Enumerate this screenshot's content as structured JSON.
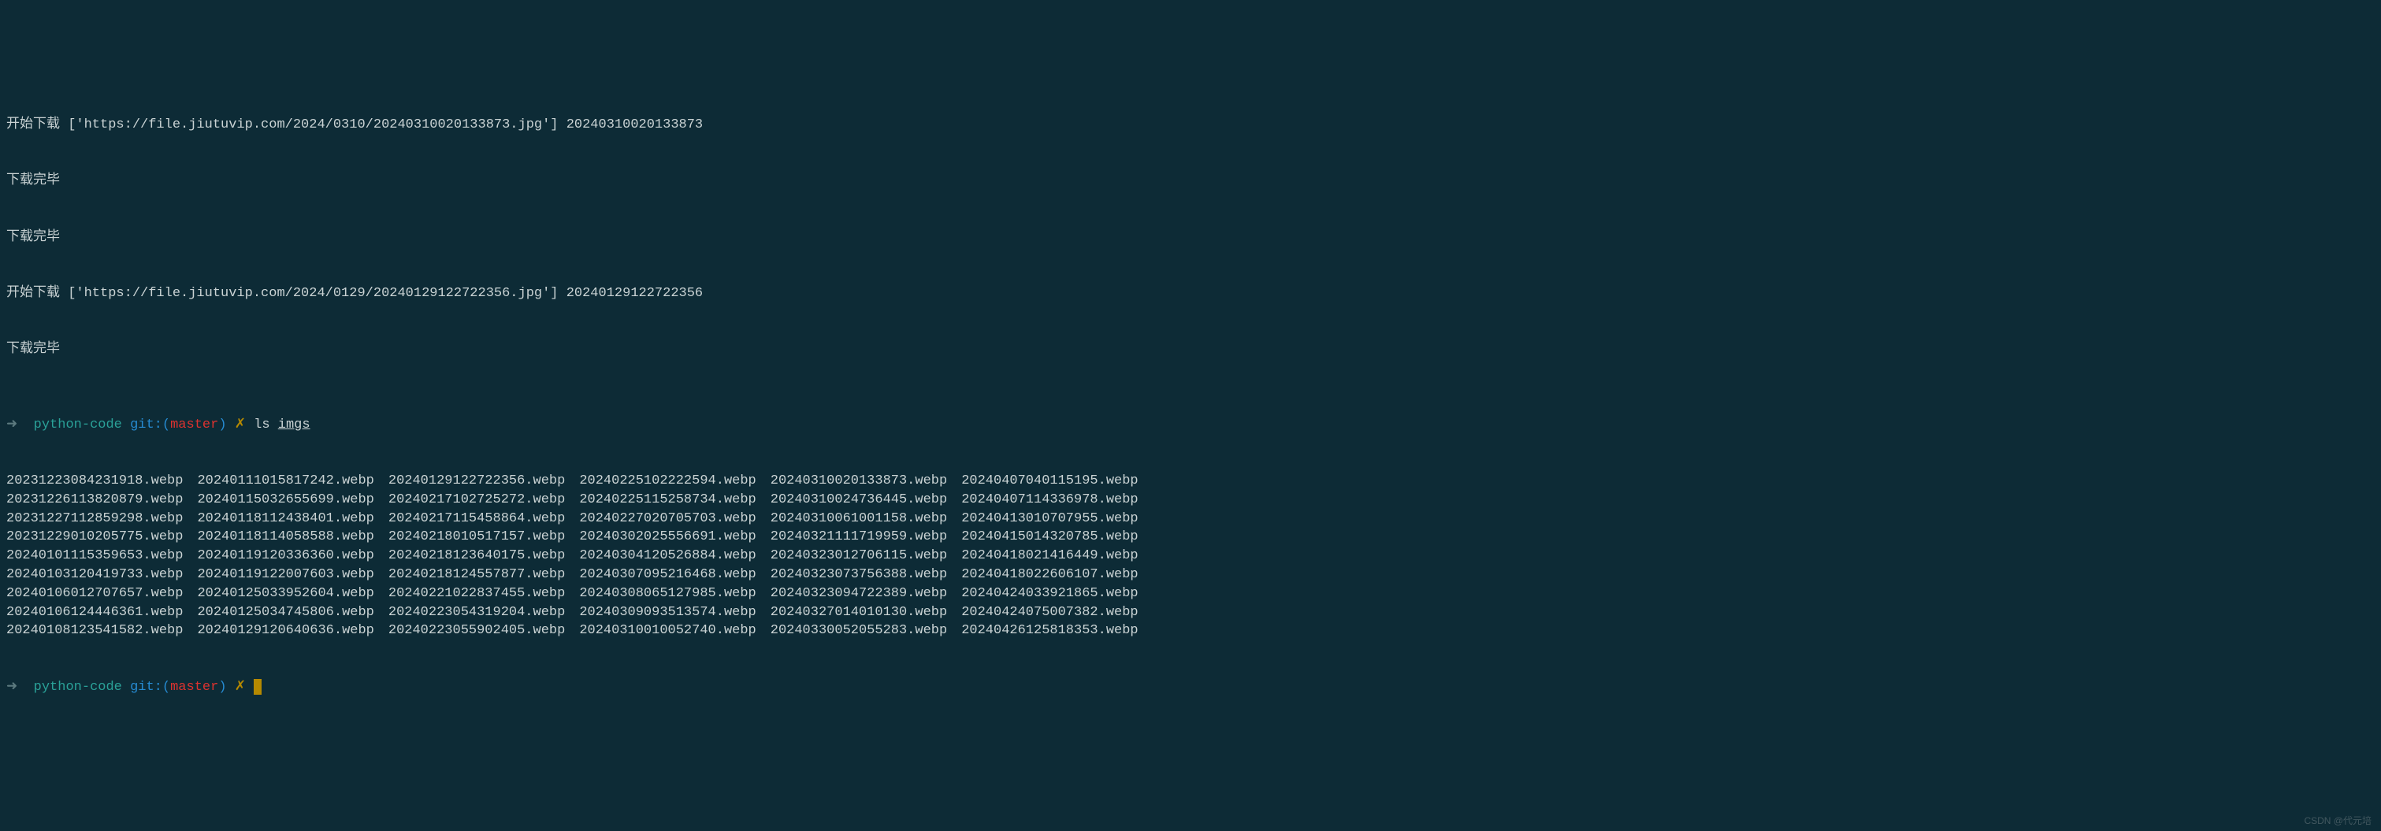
{
  "output": {
    "lines": [
      {
        "type": "start",
        "text": "开始下载 ['https://file.jiutuvip.com/2024/0310/20240310020133873.jpg'] 20240310020133873"
      },
      {
        "type": "done",
        "text": "下载完毕"
      },
      {
        "type": "done",
        "text": "下载完毕"
      },
      {
        "type": "start",
        "text": "开始下载 ['https://file.jiutuvip.com/2024/0129/20240129122722356.jpg'] 20240129122722356"
      },
      {
        "type": "done",
        "text": "下载完毕"
      }
    ]
  },
  "prompt1": {
    "arrow": "➜",
    "path": "python-code",
    "git_label": "git:(",
    "branch": "master",
    "git_close": ")",
    "dirty": "✗",
    "command": "ls",
    "arg": "imgs"
  },
  "files": {
    "cols": [
      [
        "20231223084231918.webp",
        "20231226113820879.webp",
        "20231227112859298.webp",
        "20231229010205775.webp",
        "20240101115359653.webp",
        "20240103120419733.webp",
        "20240106012707657.webp",
        "20240106124446361.webp",
        "20240108123541582.webp"
      ],
      [
        "20240111015817242.webp",
        "20240115032655699.webp",
        "20240118112438401.webp",
        "20240118114058588.webp",
        "20240119120336360.webp",
        "20240119122007603.webp",
        "20240125033952604.webp",
        "20240125034745806.webp",
        "20240129120640636.webp"
      ],
      [
        "20240129122722356.webp",
        "20240217102725272.webp",
        "20240217115458864.webp",
        "20240218010517157.webp",
        "20240218123640175.webp",
        "20240218124557877.webp",
        "20240221022837455.webp",
        "20240223054319204.webp",
        "20240223055902405.webp"
      ],
      [
        "20240225102222594.webp",
        "20240225115258734.webp",
        "20240227020705703.webp",
        "20240302025556691.webp",
        "20240304120526884.webp",
        "20240307095216468.webp",
        "20240308065127985.webp",
        "20240309093513574.webp",
        "20240310010052740.webp"
      ],
      [
        "20240310020133873.webp",
        "20240310024736445.webp",
        "20240310061001158.webp",
        "20240321111719959.webp",
        "20240323012706115.webp",
        "20240323073756388.webp",
        "20240323094722389.webp",
        "20240327014010130.webp",
        "20240330052055283.webp"
      ],
      [
        "20240407040115195.webp",
        "20240407114336978.webp",
        "20240413010707955.webp",
        "20240415014320785.webp",
        "20240418021416449.webp",
        "20240418022606107.webp",
        "20240424033921865.webp",
        "20240424075007382.webp",
        "20240426125818353.webp"
      ]
    ]
  },
  "prompt2": {
    "arrow": "➜",
    "path": "python-code",
    "git_label": "git:(",
    "branch": "master",
    "git_close": ")",
    "dirty": "✗"
  },
  "watermark": "CSDN @代元培"
}
